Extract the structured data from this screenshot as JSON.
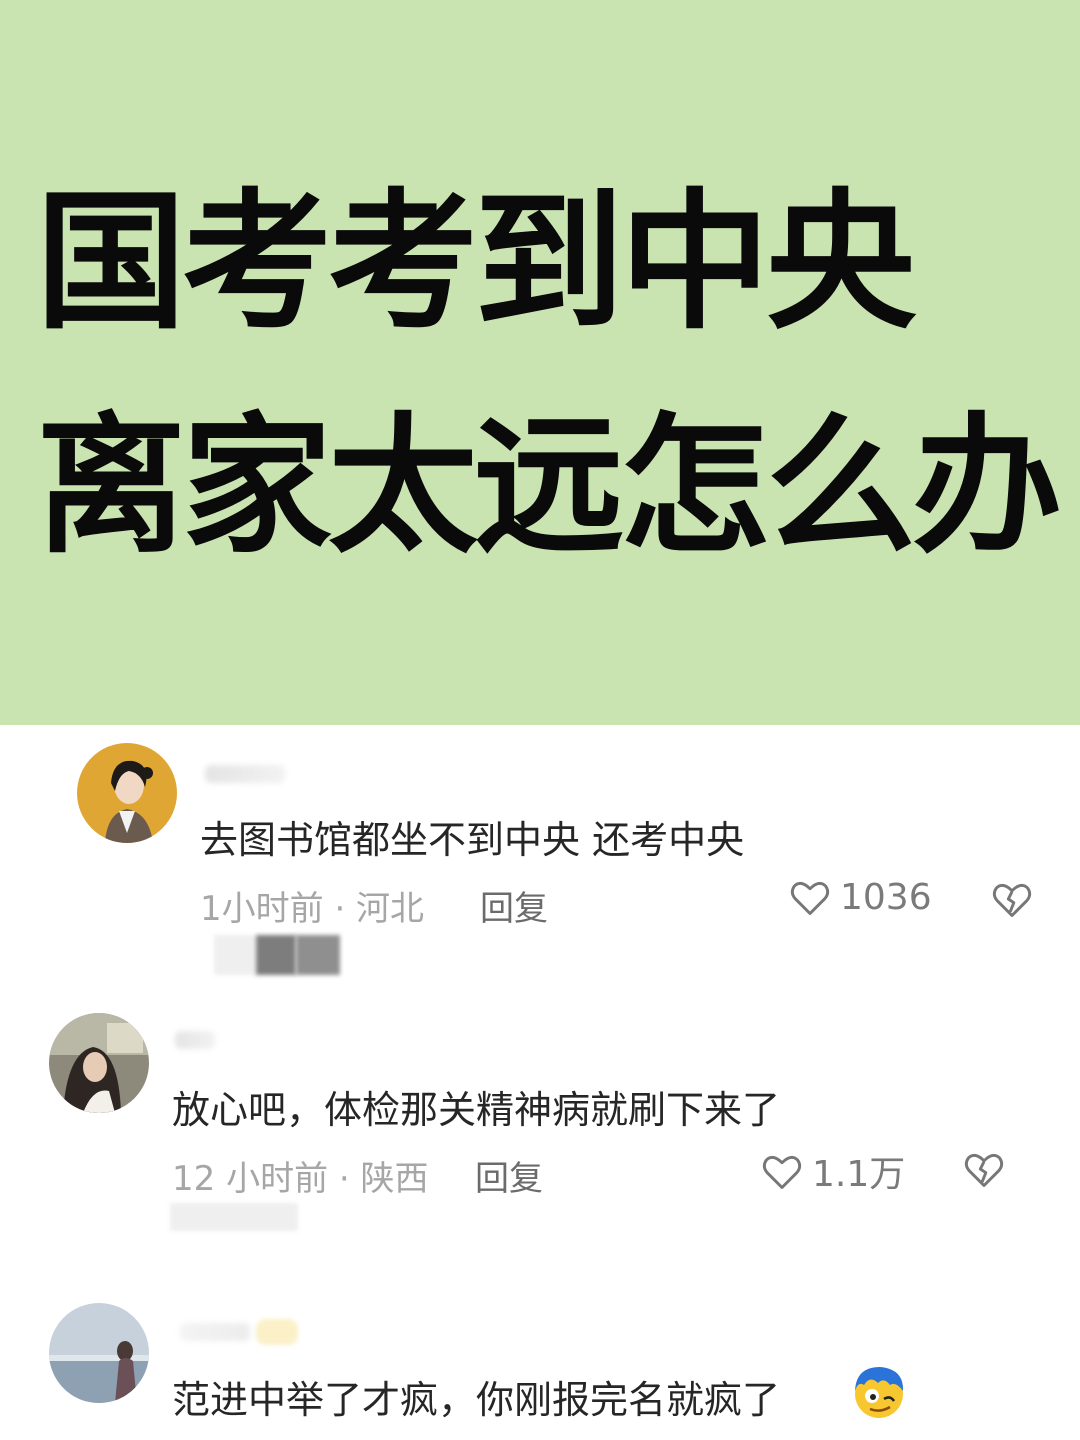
{
  "banner": {
    "line1": "国考考到中央",
    "line2": "离家太远怎么办",
    "background": "#c9e4b1"
  },
  "comments": [
    {
      "text": "去图书馆都坐不到中央  还考中央",
      "meta": "1小时前 · 河北",
      "reply": "回复",
      "likes": "1036"
    },
    {
      "text": "放心吧，体检那关精神病就刷下来了",
      "meta": "12 小时前 · 陕西",
      "reply": "回复",
      "likes": "1.1万"
    },
    {
      "text": "范进中举了才疯，你刚报完名就疯了"
    }
  ]
}
